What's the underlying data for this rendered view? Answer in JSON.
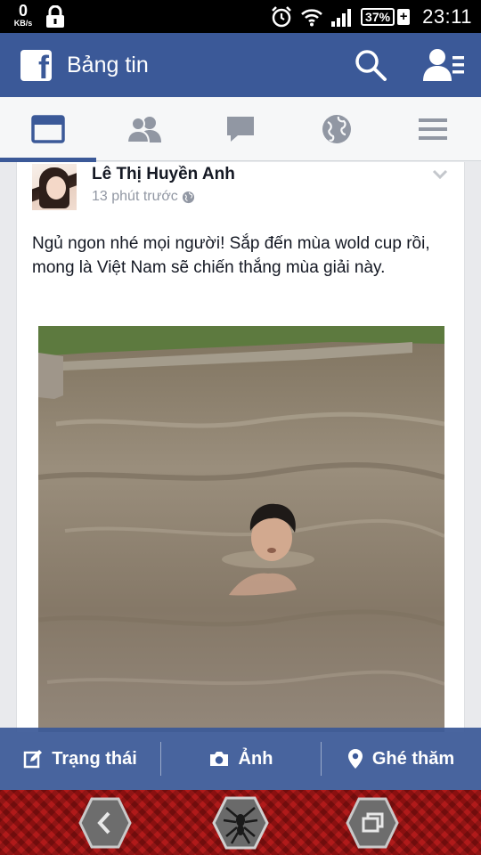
{
  "status_bar": {
    "net_speed": "0",
    "net_unit": "KB/s",
    "battery": "37%",
    "time": "23:11"
  },
  "top_bar": {
    "title": "Bảng tin",
    "icons": [
      "facebook-logo-icon",
      "search-icon",
      "friend-requests-icon"
    ]
  },
  "nav_tabs": {
    "active": "news-feed",
    "items": [
      "news-feed-icon",
      "friends-icon",
      "messages-icon",
      "notifications-globe-icon",
      "menu-icon"
    ]
  },
  "post": {
    "author": "Lê Thị Huyền Anh",
    "time": "13 phút trước",
    "privacy_icon": "globe-icon",
    "text": "Ngủ ngon nhé mọi người! Sắp đến mùa wold cup rồi, mong là Việt Nam sẽ chiến thắng mùa giải này."
  },
  "action_bar": {
    "status_label": "Trạng thái",
    "photo_label": "Ảnh",
    "checkin_label": "Ghé thăm"
  },
  "colors": {
    "brand": "#3b5998",
    "status_bar": "#000000",
    "background": "#e9eaed"
  }
}
